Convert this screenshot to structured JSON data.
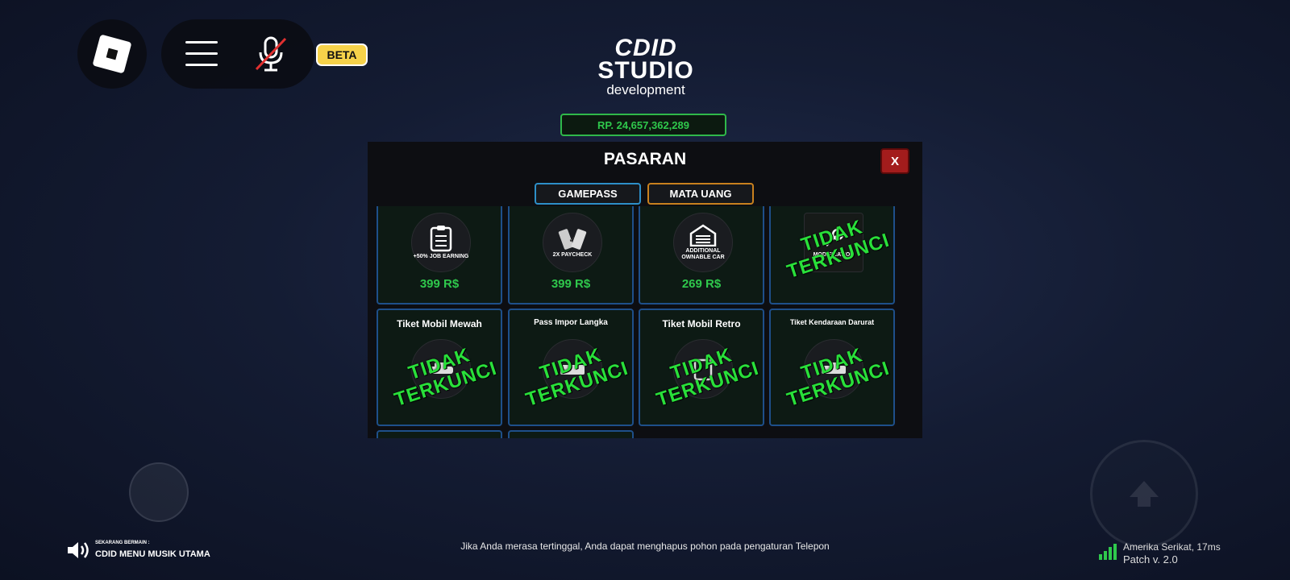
{
  "top_bar": {
    "beta_label": "BETA"
  },
  "logo": {
    "line1": "CDID",
    "line2": "STUDIO",
    "line3": "development"
  },
  "balance": "RP. 24,657,362,289",
  "market": {
    "title": "PASARAN",
    "close_label": "X",
    "tabs": [
      {
        "label": "GAMEPASS",
        "border_color": "#2d8fc8"
      },
      {
        "label": "MATA UANG",
        "border_color": "#c8801e"
      }
    ],
    "row1": [
      {
        "icon": "clipboard-icon",
        "caption": "+50% JOB EARNING",
        "price": "399 R$"
      },
      {
        "icon": "money-icon",
        "caption": "2X PAYCHECK",
        "price": "399 R$"
      },
      {
        "icon": "garage-icon",
        "caption": "ADDITIONAL OWNABLE CAR",
        "price": "269 R$"
      },
      {
        "icon": "wrench-icon",
        "caption": "MODIFICATION",
        "locked": "TIDAK TERKUNCI"
      }
    ],
    "row2": [
      {
        "title": "Tiket Mobil Mewah",
        "locked": "TIDAK TERKUNCI"
      },
      {
        "title": "Pass Impor Langka",
        "locked": "TIDAK TERKUNCI"
      },
      {
        "title": "Tiket Mobil Retro",
        "locked": "TIDAK TERKUNCI"
      },
      {
        "title": "Tiket Kendaraan Darurat",
        "locked": "TIDAK TERKUNCI"
      }
    ]
  },
  "music": {
    "label": "SEKARANG BERMAIN :",
    "title": "CDID MENU MUSIK UTAMA"
  },
  "hint": "Jika Anda merasa tertinggal, Anda dapat menghapus pohon pada pengaturan Telepon",
  "server": {
    "region": "Amerika Serikat, 17ms",
    "patch": "Patch v. 2.0"
  },
  "colors": {
    "accent_green": "#2fc84c",
    "locked_green": "#29e03a",
    "card_border": "#1e4f8a",
    "close_red": "#a31c1c",
    "beta_yellow": "#f6d24a"
  }
}
